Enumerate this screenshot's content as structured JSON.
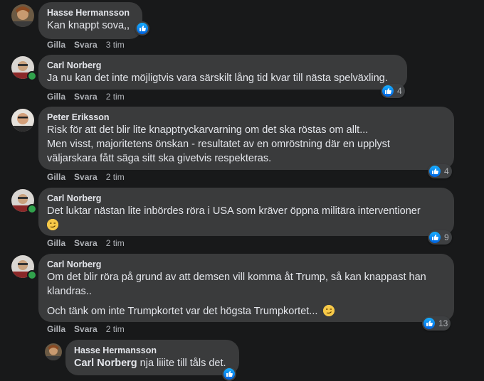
{
  "colors": {
    "background": "#18191a",
    "bubble": "#3a3b3c",
    "like_blue": "#1877f2",
    "online_green": "#31a24c"
  },
  "comments": [
    {
      "author": "Hasse Hermansson",
      "lines": [
        "Kan knappt sova,,"
      ],
      "like_label": "Gilla",
      "reply_label": "Svara",
      "time": "3 tim",
      "reaction_icon": "like-icon",
      "reaction_count": ""
    },
    {
      "author": "Carl Norberg",
      "lines": [
        "Ja nu kan det inte möjligtvis vara särskilt lång tid kvar till nästa spelväxling."
      ],
      "like_label": "Gilla",
      "reply_label": "Svara",
      "time": "2 tim",
      "reaction_icon": "like-icon",
      "reaction_count": "4"
    },
    {
      "author": "Peter Eriksson",
      "lines": [
        "Risk för att det blir lite knapptryckarvarning om det ska röstas om allt...",
        "Men visst, majoritetens önskan - resultatet av en omröstning där en upplyst",
        "väljarskara fått säga sitt ska givetvis respekteras."
      ],
      "like_label": "Gilla",
      "reply_label": "Svara",
      "time": "2 tim",
      "reaction_icon": "like-icon",
      "reaction_count": "4"
    },
    {
      "author": "Carl Norberg",
      "lines": [
        "Det luktar nästan lite inbördes röra i USA som kräver öppna militära interventioner"
      ],
      "emoji": "smirk-emoji",
      "like_label": "Gilla",
      "reply_label": "Svara",
      "time": "2 tim",
      "reaction_icon": "like-icon",
      "reaction_count": "9"
    },
    {
      "author": "Carl Norberg",
      "lines": [
        "Om det blir röra på grund av att demsen vill komma åt Trump, så kan knappast han",
        "klandras..",
        "Och tänk om inte Trumpkortet var det högsta Trumpkortet..."
      ],
      "emoji": "smirk-emoji",
      "like_label": "Gilla",
      "reply_label": "Svara",
      "time": "2 tim",
      "reaction_icon": "like-icon",
      "reaction_count": "13"
    },
    {
      "author": "Hasse Hermansson",
      "mention": "Carl Norberg",
      "lines": [
        "nja liiite till tåls det."
      ],
      "reaction_icon": "like-icon",
      "reaction_count": ""
    }
  ]
}
